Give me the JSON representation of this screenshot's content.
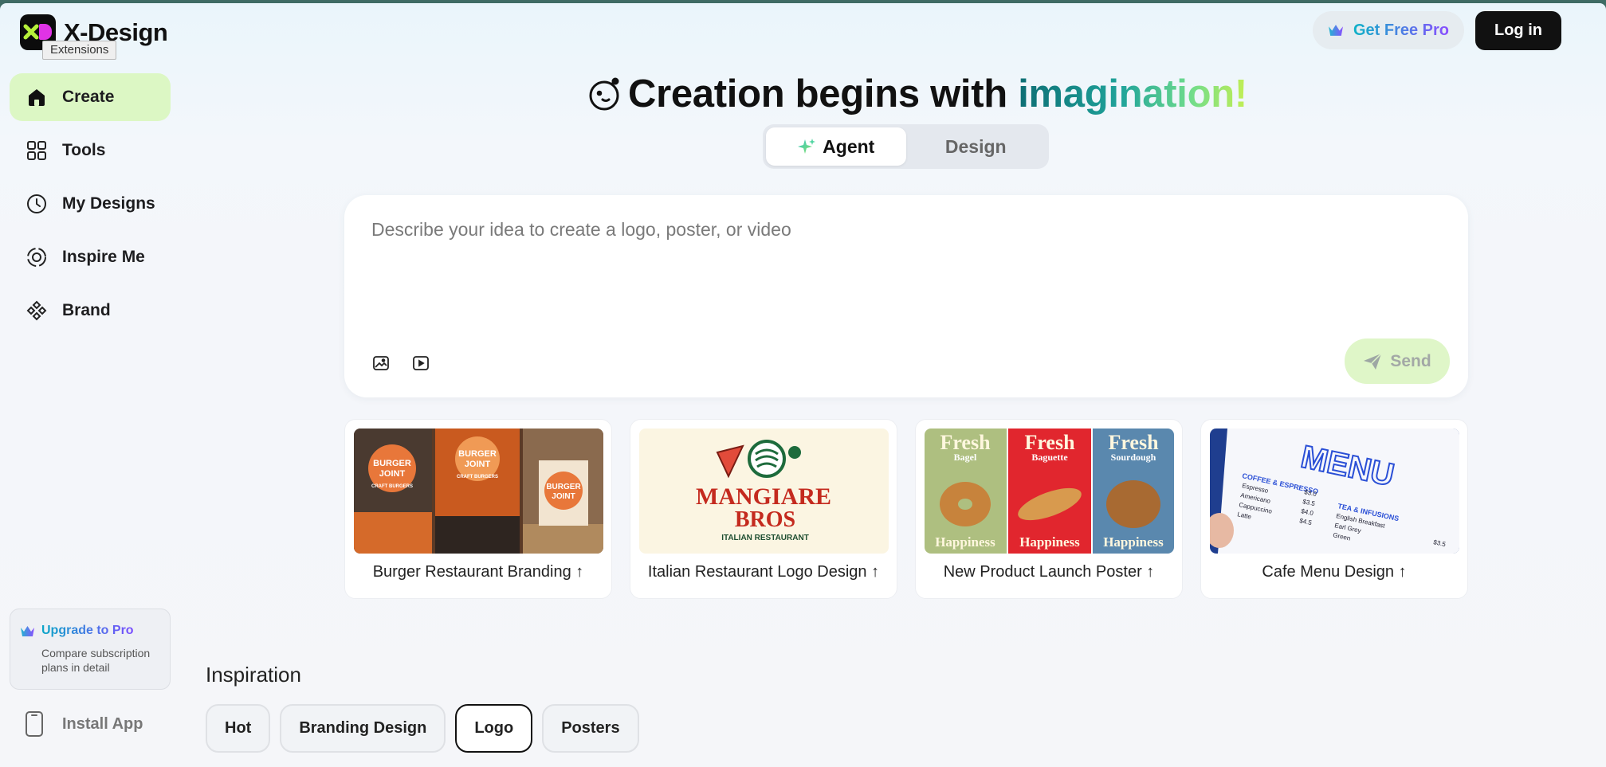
{
  "app": {
    "name": "X-Design",
    "tooltip": "Extensions"
  },
  "sidebar": {
    "items": [
      {
        "label": "Create",
        "icon": "home-icon",
        "active": true
      },
      {
        "label": "Tools",
        "icon": "grid-icon"
      },
      {
        "label": "My Designs",
        "icon": "clock-icon"
      },
      {
        "label": "Inspire Me",
        "icon": "target-icon"
      },
      {
        "label": "Brand",
        "icon": "diamond-cluster-icon"
      }
    ],
    "upgrade": {
      "title": "Upgrade to Pro",
      "description": "Compare subscription plans in detail"
    },
    "install": "Install App"
  },
  "header": {
    "pro_label": "Get Free Pro",
    "login_label": "Log in"
  },
  "hero": {
    "title_main": "Creation begins with ",
    "title_accent": "imagination!"
  },
  "mode": {
    "tabs": [
      {
        "label": "Agent",
        "active": true
      },
      {
        "label": "Design",
        "active": false
      }
    ]
  },
  "prompt": {
    "placeholder": "Describe your idea to create a logo, poster, or video",
    "value": "",
    "send_label": "Send"
  },
  "examples": [
    {
      "label": "Burger Restaurant Branding ↑"
    },
    {
      "label": "Italian Restaurant Logo Design ↑"
    },
    {
      "label": "New Product Launch Poster ↑"
    },
    {
      "label": "Cafe Menu Design ↑"
    }
  ],
  "thumbs": {
    "burger_text": [
      "BURGER",
      "JOINT",
      "CRAFT BURGERS"
    ],
    "italian_text": [
      "MANGIARE",
      "BROS",
      "ITALIAN RESTAURANT"
    ],
    "bread": [
      {
        "word": "Fresh",
        "sub": "Bagel",
        "foot": "Happiness"
      },
      {
        "word": "Fresh",
        "sub": "Baguette",
        "foot": "Happiness"
      },
      {
        "word": "Fresh",
        "sub": "Sourdough",
        "foot": "Happiness"
      }
    ],
    "menu_title": "MENU",
    "menu_sections": [
      "COFFEE & ESPRESSO",
      "TEA & INFUSIONS"
    ],
    "menu_items": [
      "Espresso",
      "Americano",
      "Cappuccino",
      "Latte",
      "English Breakfast",
      "Earl Grey",
      "Green"
    ],
    "menu_prices": [
      "$3.0",
      "$3.5",
      "$4.0",
      "$4.5",
      "$3.5"
    ]
  },
  "inspiration": {
    "title": "Inspiration",
    "chips": [
      {
        "label": "Hot",
        "active": false
      },
      {
        "label": "Branding Design",
        "active": false
      },
      {
        "label": "Logo",
        "active": true
      },
      {
        "label": "Posters",
        "active": false
      }
    ]
  }
}
